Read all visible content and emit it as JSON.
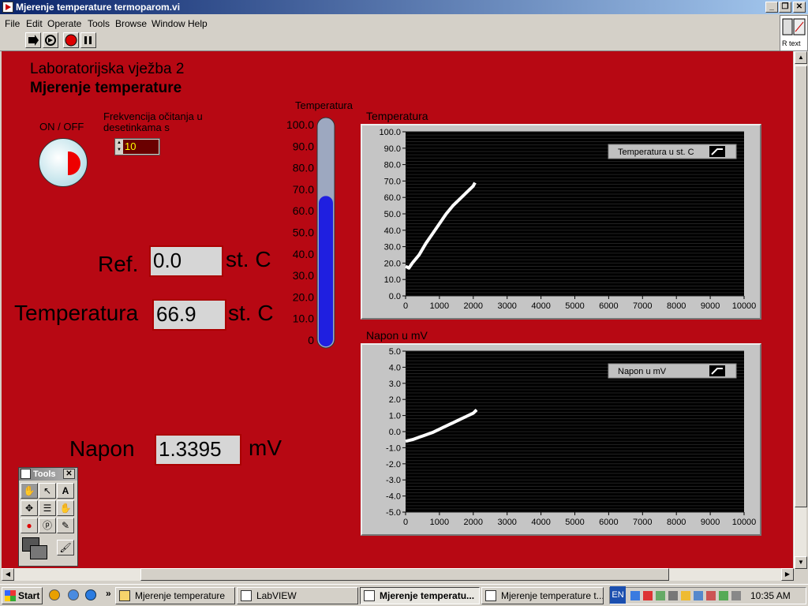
{
  "window": {
    "title": "Mjerenje temperature termoparom.vi"
  },
  "menu": [
    "File",
    "Edit",
    "Operate",
    "Tools",
    "Browse",
    "Window",
    "Help"
  ],
  "rtext_label": "R text",
  "panel": {
    "heading1": "Laboratorijska vježba 2",
    "heading2": "Mjerenje temperature",
    "onoff_label": "ON / OFF",
    "freq_label_line1": "Frekvencija očitanja u",
    "freq_label_line2": "desetinkama s",
    "freq_value": "10",
    "ref_label": "Ref.",
    "ref_value": "0.0",
    "ref_unit": "st. C",
    "temp_label": "Temperatura",
    "temp_value": "66.9",
    "temp_unit": "st. C",
    "napon_label": "Napon",
    "napon_value": "1.3395",
    "napon_unit": "mV",
    "thermo_label": "Temperatura",
    "thermo_ticks": [
      "100.0",
      "90.0",
      "80.0",
      "70.0",
      "60.0",
      "50.0",
      "40.0",
      "30.0",
      "20.0",
      "10.0",
      "0"
    ],
    "thermo_level": 66.9
  },
  "tools": {
    "title": "Tools"
  },
  "chart_data": [
    {
      "type": "line",
      "title": "Temperatura",
      "legend": "Temperatura u st. C",
      "xlim": [
        0,
        10000
      ],
      "ylim": [
        0,
        100
      ],
      "xticks": [
        "0",
        "1000",
        "2000",
        "3000",
        "4000",
        "5000",
        "6000",
        "7000",
        "8000",
        "9000",
        "10000"
      ],
      "yticks": [
        "100.0",
        "90.0",
        "80.0",
        "70.0",
        "60.0",
        "50.0",
        "40.0",
        "30.0",
        "20.0",
        "10.0",
        "0.0"
      ],
      "series": [
        {
          "x": [
            0,
            100,
            200,
            400,
            600,
            800,
            1000,
            1200,
            1400,
            1600,
            1800,
            2000,
            2050
          ],
          "y": [
            18,
            17,
            20,
            25,
            32,
            38,
            44,
            50,
            55,
            59,
            63,
            67,
            69
          ]
        }
      ]
    },
    {
      "type": "line",
      "title": "Napon u mV",
      "legend": "Napon u mV",
      "xlim": [
        0,
        10000
      ],
      "ylim": [
        -5,
        5
      ],
      "xticks": [
        "0",
        "1000",
        "2000",
        "3000",
        "4000",
        "5000",
        "6000",
        "7000",
        "8000",
        "9000",
        "10000"
      ],
      "yticks": [
        "5.0",
        "4.0",
        "3.0",
        "2.0",
        "1.0",
        "0.0",
        "-1.0",
        "-2.0",
        "-3.0",
        "-4.0",
        "-5.0"
      ],
      "series": [
        {
          "x": [
            0,
            200,
            400,
            600,
            800,
            1000,
            1200,
            1400,
            1600,
            1800,
            2000,
            2100
          ],
          "y": [
            -0.6,
            -0.5,
            -0.35,
            -0.2,
            -0.05,
            0.15,
            0.35,
            0.55,
            0.75,
            0.95,
            1.15,
            1.35
          ]
        }
      ]
    }
  ],
  "taskbar": {
    "start": "Start",
    "tasks": [
      "Mjerenje temperature",
      "LabVIEW",
      "Mjerenje temperatu...",
      "Mjerenje temperature t..."
    ],
    "lang": "EN",
    "clock": "10:35 AM"
  },
  "colors": {
    "panel": "#b70813",
    "plot_bg": "#000000",
    "trace": "#ffffff",
    "thermo_fill": "#1f1fe0"
  }
}
